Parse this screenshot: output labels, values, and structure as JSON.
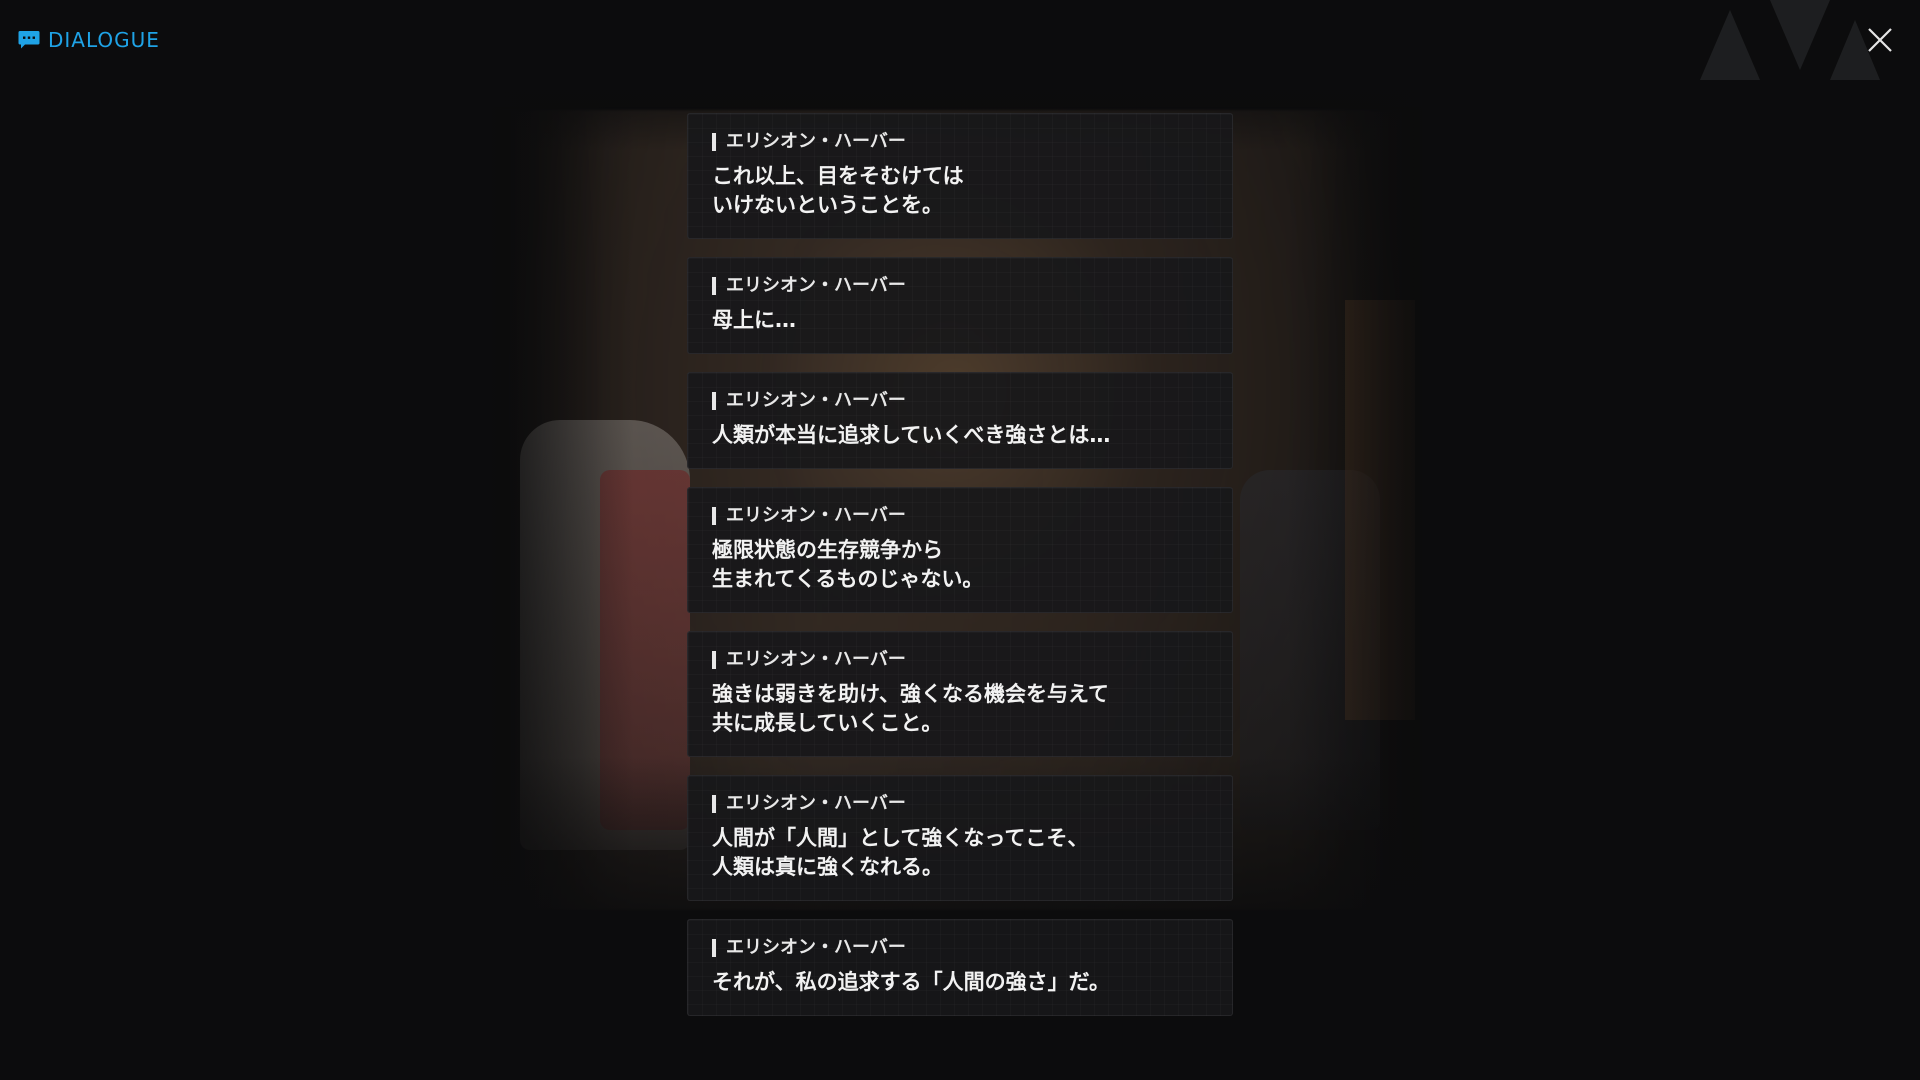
{
  "header": {
    "title": "DIALOGUE",
    "title_icon": "chat-bubble-icon",
    "close_icon": "close-icon",
    "accent_color": "#1fa3e6"
  },
  "dialogue": [
    {
      "speaker": "エリシオン・ハーバー",
      "text": "これ以上、目をそむけては\nいけないということを。"
    },
    {
      "speaker": "エリシオン・ハーバー",
      "text": "母上に…"
    },
    {
      "speaker": "エリシオン・ハーバー",
      "text": "人類が本当に追求していくべき強さとは…"
    },
    {
      "speaker": "エリシオン・ハーバー",
      "text": "極限状態の生存競争から\n生まれてくるものじゃない。"
    },
    {
      "speaker": "エリシオン・ハーバー",
      "text": "強きは弱きを助け、強くなる機会を与えて\n共に成長していくこと。"
    },
    {
      "speaker": "エリシオン・ハーバー",
      "text": "人間が「人間」として強くなってこそ、\n人類は真に強くなれる。"
    },
    {
      "speaker": "エリシオン・ハーバー",
      "text": "それが、私の追求する「人間の強さ」だ。"
    }
  ]
}
